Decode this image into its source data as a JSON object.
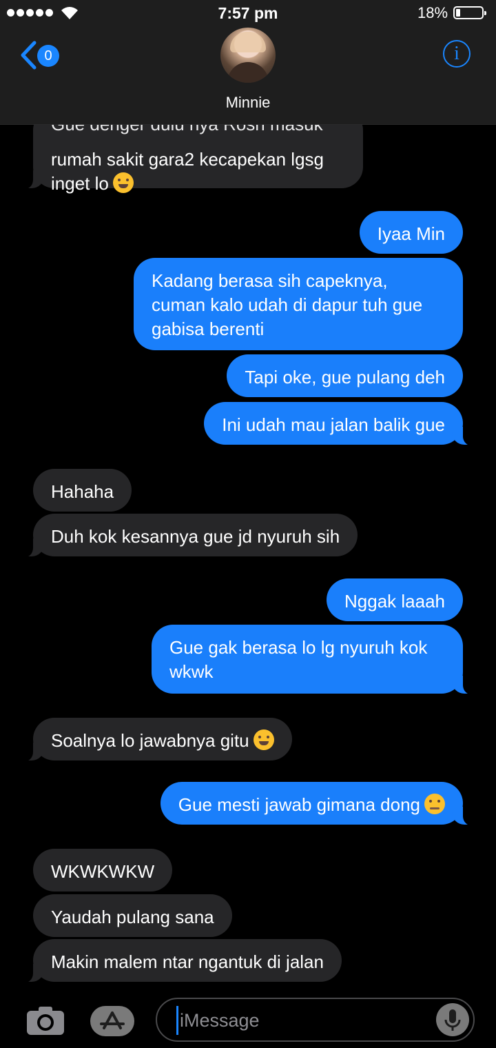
{
  "status_bar": {
    "time": "7:57 pm",
    "battery": "18%"
  },
  "header": {
    "back_badge": "0",
    "contact_name": "Minnie",
    "info_label": "i"
  },
  "messages": [
    {
      "text": "Gue denger dulu nya Rosh masuk",
      "clipped": true
    },
    {
      "text": "rumah sakit gara2 kecapekan lgsg"
    },
    {
      "text": "inget lo"
    },
    {
      "text": "Iyaa Min"
    },
    {
      "text": "Kadang berasa sih capeknya,"
    },
    {
      "text": "cuman kalo udah di dapur tuh gue"
    },
    {
      "text": "gabisa berenti"
    },
    {
      "text": "Tapi oke, gue pulang deh"
    },
    {
      "text": "Ini udah mau jalan balik gue"
    },
    {
      "text": "Hahaha"
    },
    {
      "text": "Duh kok kesannya gue jd nyuruh sih"
    },
    {
      "text": "Nggak laaah"
    },
    {
      "text": "Gue gak berasa lo lg nyuruh kok"
    },
    {
      "text": "wkwk"
    },
    {
      "text": "Soalnya lo jawabnya gitu"
    },
    {
      "text": "Gue mesti jawab gimana dong"
    },
    {
      "text": "WKWKWKW"
    },
    {
      "text": "Yaudah pulang sana"
    },
    {
      "text": "Makin malem ntar ngantuk di jalan"
    }
  ],
  "input": {
    "placeholder": "iMessage"
  },
  "icons": {
    "back": "chevron-left-icon",
    "info": "info-icon",
    "camera": "camera-icon",
    "app_store": "app-store-icon",
    "mic": "microphone-icon",
    "emoji_laugh": "tears-of-joy-emoji",
    "emoji_sad": "pensive-face-emoji"
  },
  "colors": {
    "accent": "#1a86ff",
    "outgoing_bubble": "#1a7ffb",
    "incoming_bubble": "#262628",
    "header_bg": "#1e1e1e"
  }
}
